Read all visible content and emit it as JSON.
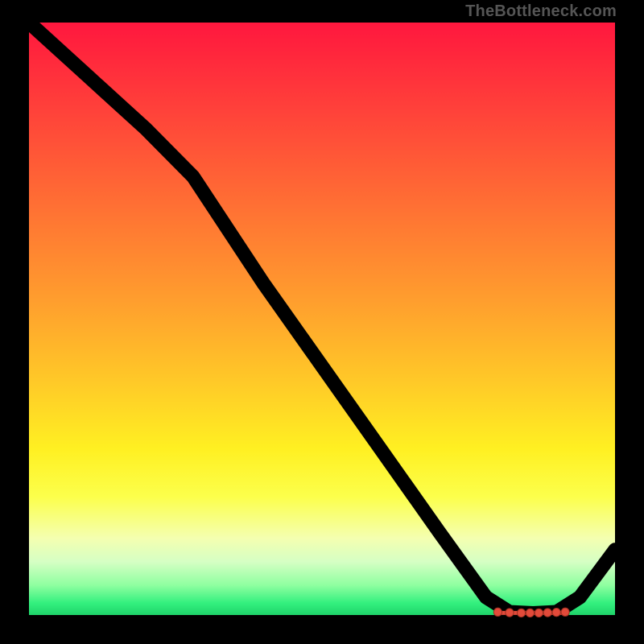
{
  "watermark": "TheBottleneck.com",
  "chart_data": {
    "type": "line",
    "title": "",
    "xlabel": "",
    "ylabel": "",
    "xlim": [
      0,
      100
    ],
    "ylim": [
      0,
      100
    ],
    "grid": false,
    "legend": false,
    "series": [
      {
        "name": "curve",
        "x": [
          0,
          10,
          20,
          28,
          40,
          50,
          60,
          70,
          78,
          82,
          86,
          90,
          94,
          100
        ],
        "y": [
          100,
          91,
          82,
          74,
          56,
          42,
          28,
          14,
          3,
          0.5,
          0.3,
          0.5,
          3,
          11
        ]
      }
    ],
    "markers": {
      "name": "dots",
      "x": [
        80,
        82,
        84,
        85.5,
        87,
        88.5,
        90,
        91.5
      ],
      "y": [
        0.5,
        0.4,
        0.35,
        0.35,
        0.35,
        0.4,
        0.45,
        0.5
      ]
    }
  }
}
